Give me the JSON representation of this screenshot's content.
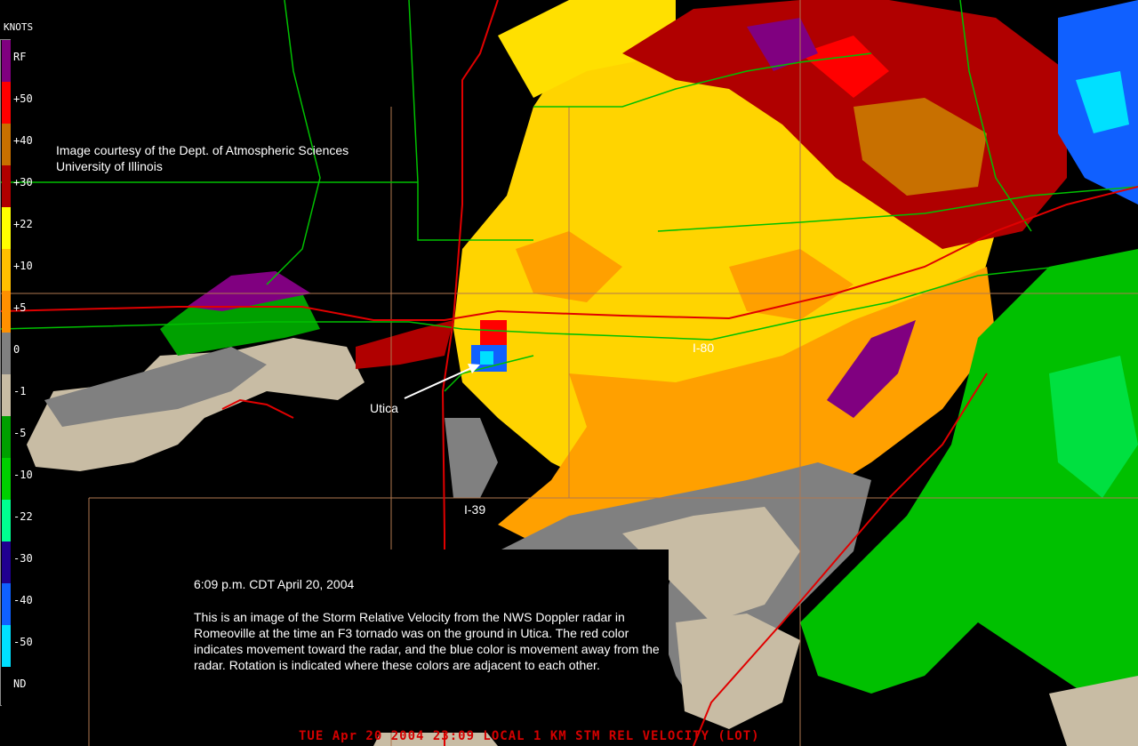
{
  "legend": {
    "title": "KNOTS",
    "bins": [
      {
        "label": "RF",
        "color": "#800080"
      },
      {
        "label": "+50",
        "color": "#ff0000"
      },
      {
        "label": "+40",
        "color": "#c87000"
      },
      {
        "label": "+30",
        "color": "#b00000"
      },
      {
        "label": "+22",
        "color": "#ffff00"
      },
      {
        "label": "+10",
        "color": "#ffc000"
      },
      {
        "label": "+5",
        "color": "#ff9000"
      },
      {
        "label": "0",
        "color": "#808080"
      },
      {
        "label": "-1",
        "color": "#c8bca4"
      },
      {
        "label": "-5",
        "color": "#00a000"
      },
      {
        "label": "-10",
        "color": "#00d000"
      },
      {
        "label": "-22",
        "color": "#00ff90"
      },
      {
        "label": "-30",
        "color": "#200090"
      },
      {
        "label": "-40",
        "color": "#1060ff"
      },
      {
        "label": "-50",
        "color": "#00e0ff"
      },
      {
        "label": "ND",
        "color": "#000000"
      }
    ]
  },
  "credit": {
    "line1": "Image courtesy of the Dept. of Atmospheric Sciences",
    "line2": "University of Illinois"
  },
  "places": {
    "utica": "Utica",
    "i80": "I-80",
    "i39": "I-39"
  },
  "info": {
    "time": "6:09 p.m. CDT April 20, 2004",
    "description": "This is an image of the Storm Relative Velocity from the NWS Doppler radar in Romeoville at the time an F3 tornado was on the ground in Utica. The red color indicates movement toward the radar, and the blue color is movement away from the radar.  Rotation is indicated where these colors are adjacent to each other."
  },
  "footer": "TUE Apr 20 2004 23:09 LOCAL   1 KM  STM REL VELOCITY (LOT)"
}
